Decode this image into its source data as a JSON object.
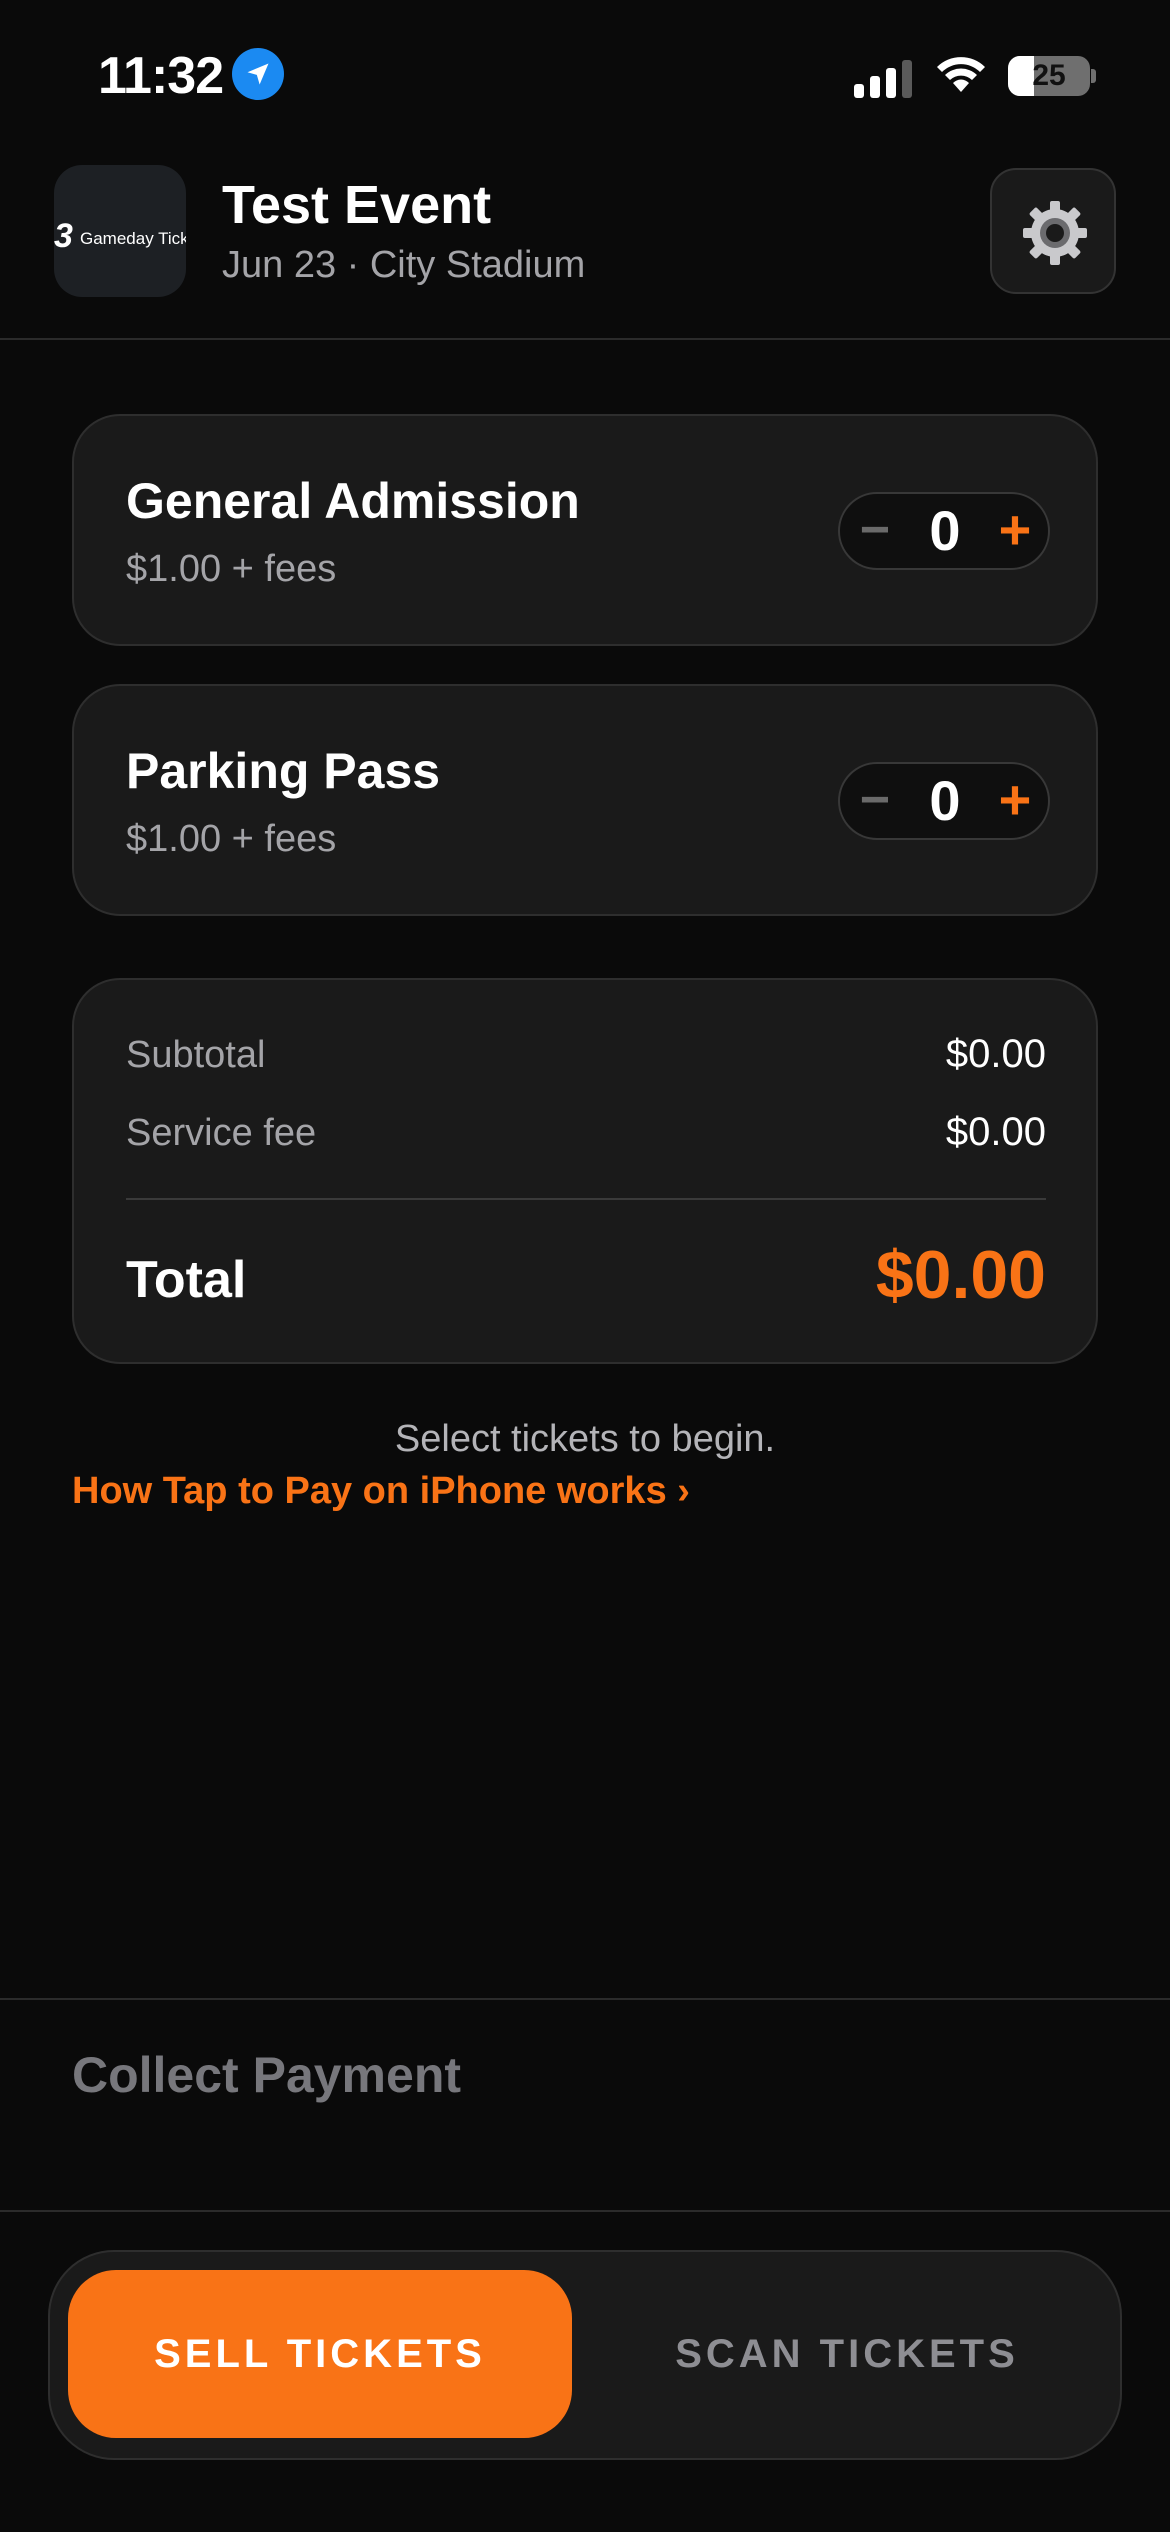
{
  "status_bar": {
    "time": "11:32",
    "battery": "25",
    "icons": [
      "location-arrow-icon",
      "cellular-signal-icon",
      "wifi-icon",
      "battery-icon"
    ]
  },
  "header": {
    "logo_text": "Gameday Tick",
    "title": "Test Event",
    "subtitle": "Jun 23 · City Stadium",
    "settings_icon": "gear-icon"
  },
  "tickets": [
    {
      "name": "General Admission",
      "price": "$1.00 + fees",
      "quantity": "0",
      "minus": "−",
      "plus": "+"
    },
    {
      "name": "Parking Pass",
      "price": "$1.00 + fees",
      "quantity": "0",
      "minus": "−",
      "plus": "+"
    }
  ],
  "summary": {
    "subtotal_label": "Subtotal",
    "subtotal_value": "$0.00",
    "fee_label": "Service fee",
    "fee_value": "$0.00",
    "total_label": "Total",
    "total_value": "$0.00"
  },
  "hint": "Select tickets to begin.",
  "howto_link": "How Tap to Pay on iPhone works ›",
  "collect_label": "Collect Payment",
  "tabs": {
    "sell": "SELL TICKETS",
    "scan": "SCAN TICKETS",
    "active": "sell"
  },
  "colors": {
    "accent": "#f97316",
    "background": "#0a0a0a",
    "card": "#1a1a1a",
    "secondary_text": "#a4a4a8",
    "location_blue": "#1b8af2"
  }
}
